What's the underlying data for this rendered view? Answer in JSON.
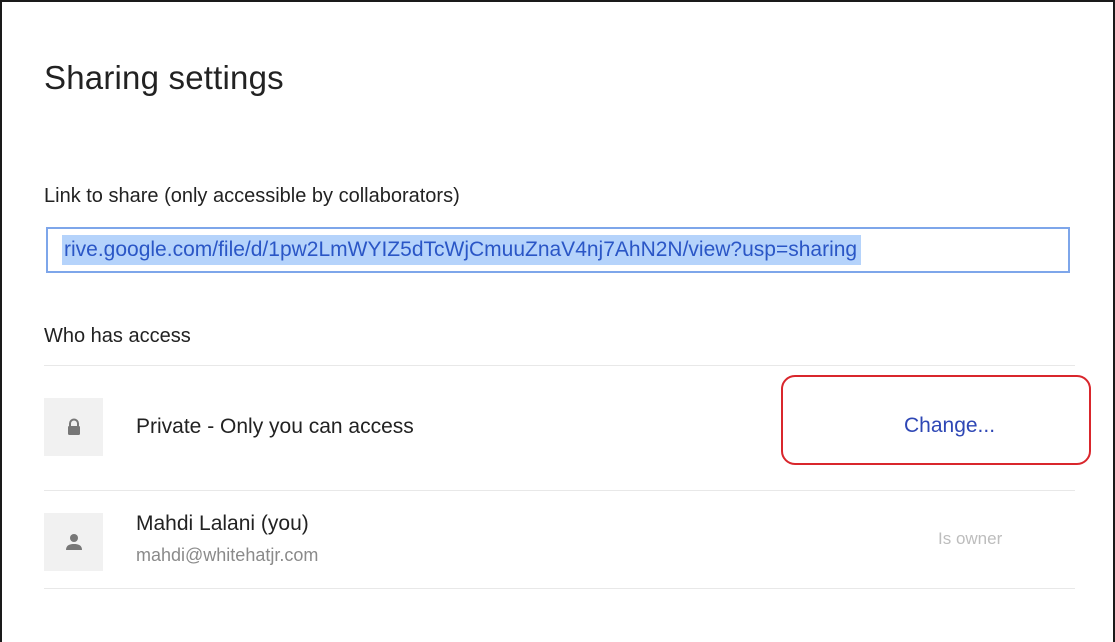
{
  "dialog": {
    "title": "Sharing settings"
  },
  "link": {
    "label": "Link to share (only accessible by collaborators)",
    "value": "rive.google.com/file/d/1pw2LmWYIZ5dTcWjCmuuZnaV4nj7AhN2N/view?usp=sharing"
  },
  "access": {
    "heading": "Who has access",
    "entries": [
      {
        "icon": "lock-icon",
        "label": "Private - Only you can access",
        "action": "Change..."
      },
      {
        "icon": "person-icon",
        "name": "Mahdi Lalani (you)",
        "email": "mahdi@whitehatjr.com",
        "role": "Is owner"
      }
    ]
  },
  "colors": {
    "link_blue": "#2e47b5",
    "selection": "#b5d3fb",
    "highlight_red": "#d9262c"
  }
}
